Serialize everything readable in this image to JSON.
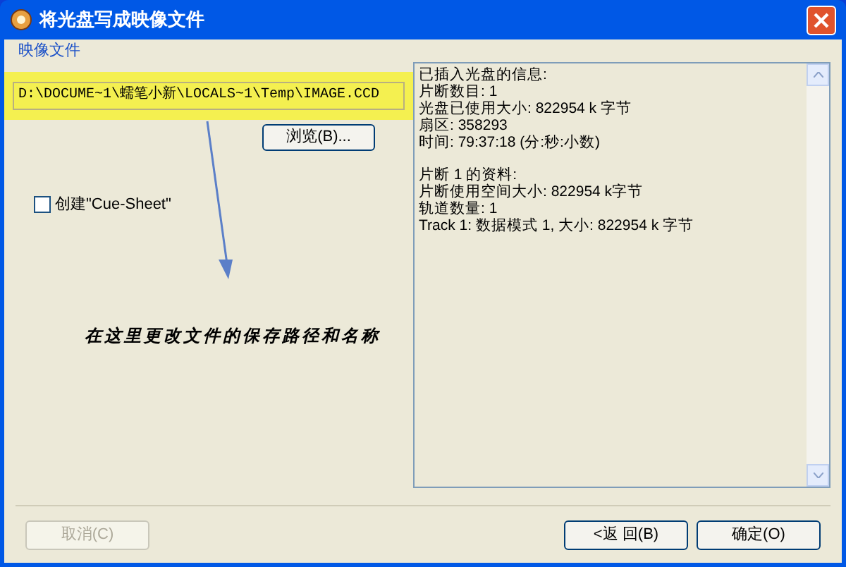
{
  "window": {
    "title": "将光盘写成映像文件"
  },
  "group_label": "映像文件",
  "path_field": {
    "value": "D:\\DOCUME~1\\蠕笔小新\\LOCALS~1\\Temp\\IMAGE.CCD",
    "highlighted": true
  },
  "browse_button": "浏览(B)...",
  "cue_sheet": {
    "label": "创建\"Cue-Sheet\"",
    "checked": false
  },
  "annotation": "在这里更改文件的保存路径和名称",
  "info_paragraphs": [
    [
      "已插入光盘的信息:",
      "片断数目: 1",
      "光盘已使用大小: 822954 k 字节",
      "扇区: 358293",
      "时间: 79:37:18 (分:秒:小数)"
    ],
    [
      "片断 1 的资料:",
      "片断使用空间大小: 822954 k字节",
      "轨道数量: 1",
      "Track 1: 数据模式 1, 大小: 822954 k 字节"
    ]
  ],
  "buttons": [
    {
      "label": "取消(C)",
      "disabled": true
    },
    {
      "label": "<返 回(B)",
      "disabled": false
    },
    {
      "label": "确定(O)",
      "disabled": false
    }
  ]
}
